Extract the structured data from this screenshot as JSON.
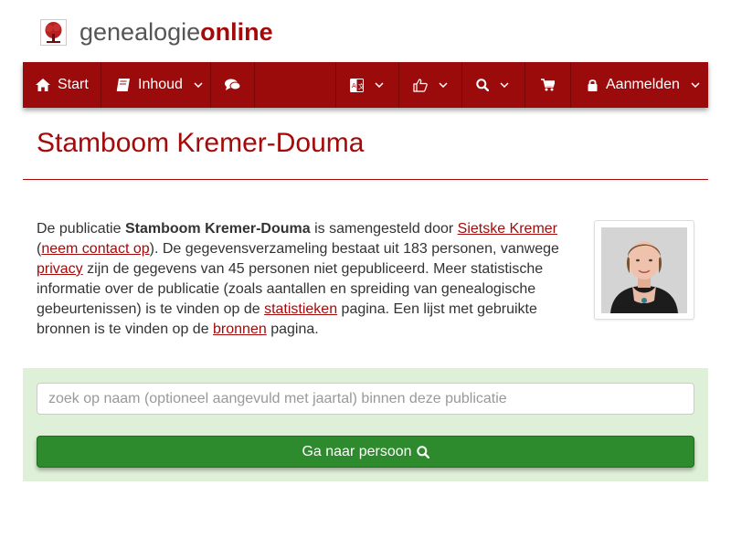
{
  "brand": {
    "name_light": "genealogie",
    "name_bold": "online",
    "logo_icon": "tree-icon"
  },
  "nav": {
    "start_label": "Start",
    "inhoud_label": "Inhoud",
    "login_label": "Aanmelden",
    "icons": [
      "home-icon",
      "book-icon",
      "comments-icon",
      "language-icon",
      "thumbs-up-icon",
      "search-icon",
      "cart-icon",
      "lock-icon"
    ]
  },
  "page": {
    "title": "Stamboom Kremer-Douma",
    "intro": {
      "t1": "De publicatie ",
      "pub_name": "Stamboom Kremer-Douma",
      "t2": " is samengesteld door ",
      "author_link": "Sietske Kremer",
      "t3": " (",
      "contact_link": "neem contact op",
      "t4": "). De gegevensverzameling bestaat uit 183 personen, vanwege ",
      "privacy_link": "privacy",
      "t5": " zijn de gegevens van 45 personen niet gepubliceerd. Meer statistische informatie over de publicatie (zoals aantallen en spreiding van genealogische gebeurtenissen) is te vinden op de ",
      "stats_link": "statistieken",
      "t6": " pagina. Een lijst met gebruikte bronnen is te vinden op de ",
      "sources_link": "bronnen",
      "t7": " pagina."
    }
  },
  "search": {
    "placeholder": "zoek op naam (optioneel aangevuld met jaartal) binnen deze publicatie",
    "button_label": "Ga naar persoon"
  },
  "colors": {
    "brand_red": "#9b0b0b",
    "link_red": "#a50a0a",
    "panel_green": "#dff0d8",
    "button_green": "#2d8a2d"
  }
}
